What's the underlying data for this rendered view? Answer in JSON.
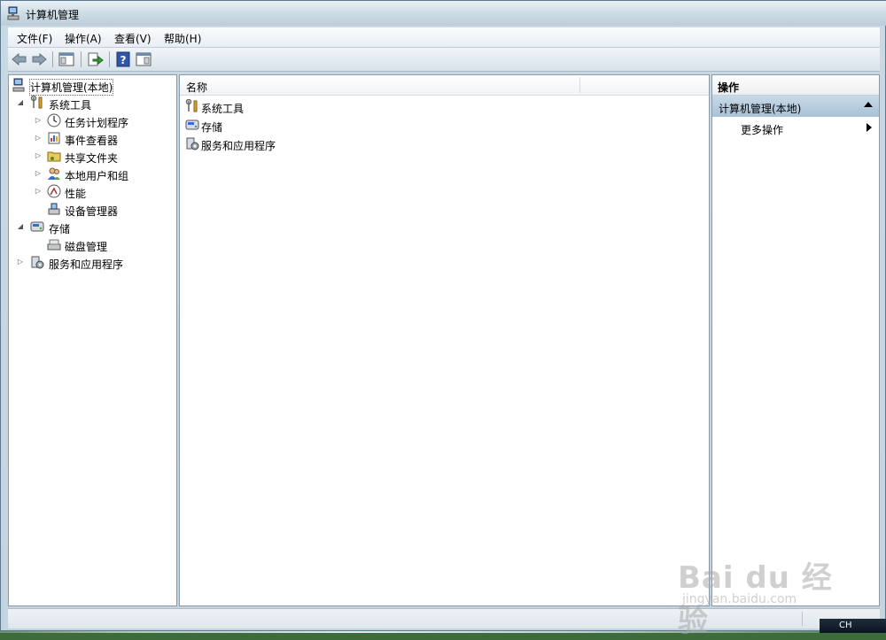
{
  "window": {
    "title": "计算机管理"
  },
  "menu": [
    {
      "label": "文件(F)"
    },
    {
      "label": "操作(A)"
    },
    {
      "label": "查看(V)"
    },
    {
      "label": "帮助(H)"
    }
  ],
  "tree": {
    "root": "计算机管理(本地)",
    "system_tools": "系统工具",
    "task_scheduler": "任务计划程序",
    "event_viewer": "事件查看器",
    "shared_folders": "共享文件夹",
    "local_users": "本地用户和组",
    "performance": "性能",
    "device_manager": "设备管理器",
    "storage": "存储",
    "disk_management": "磁盘管理",
    "services_apps": "服务和应用程序"
  },
  "content": {
    "column_name": "名称",
    "items": [
      "系统工具",
      "存储",
      "服务和应用程序"
    ]
  },
  "actions": {
    "title": "操作",
    "group": "计算机管理(本地)",
    "more": "更多操作"
  },
  "tray": {
    "lang": "CH"
  },
  "watermark": {
    "brand": "Bai du 经验",
    "url": "jingyan.baidu.com"
  }
}
